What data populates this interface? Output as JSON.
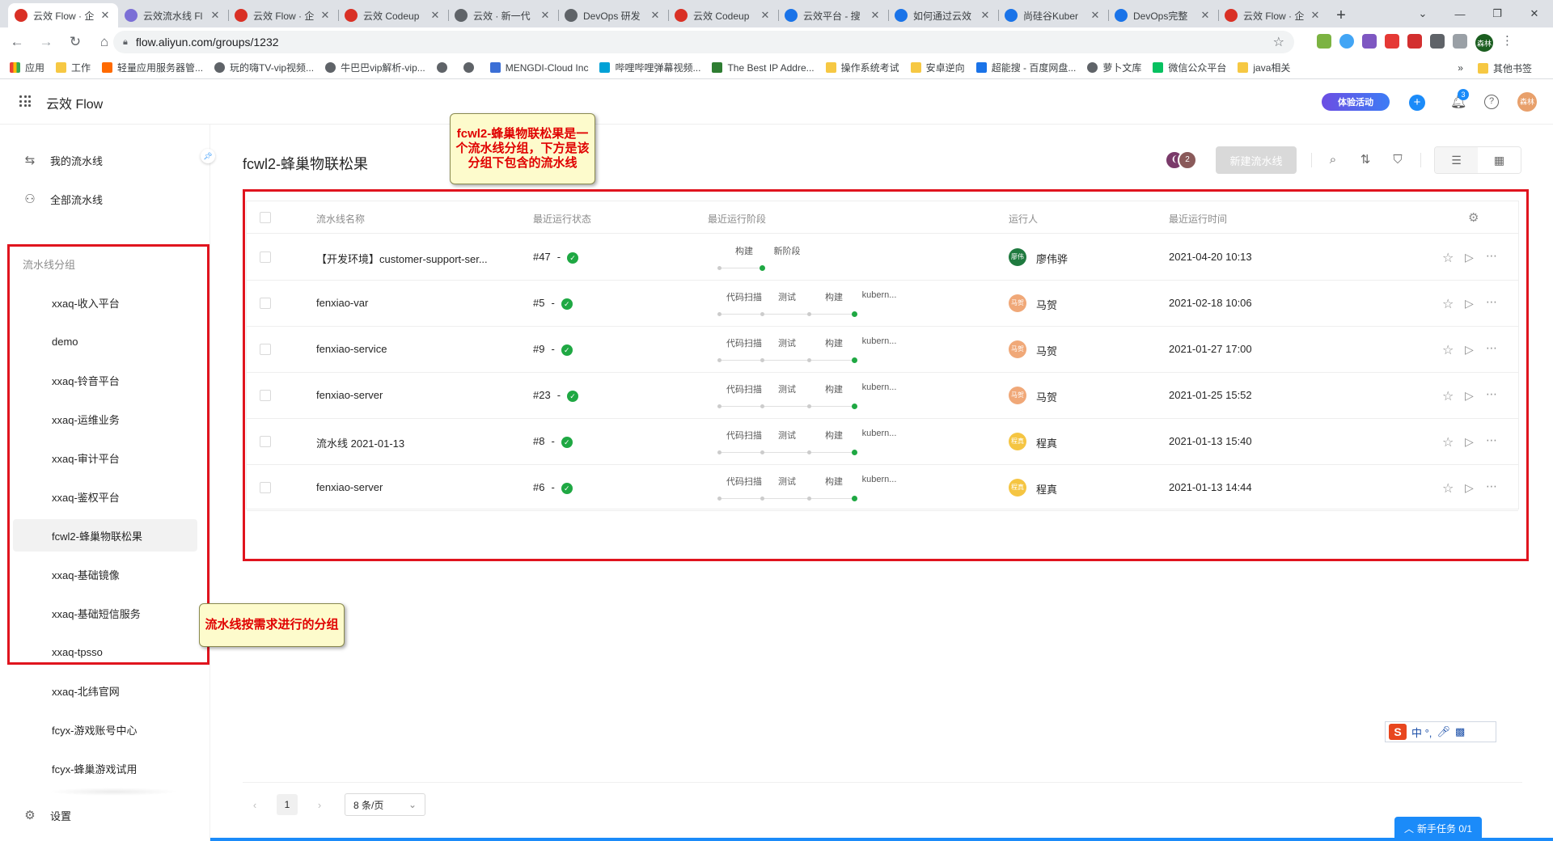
{
  "browser": {
    "tabs": [
      {
        "title": "云效 Flow · 企",
        "active": true,
        "icon_color": "#d93025"
      },
      {
        "title": "云效流水线 Fl",
        "active": false,
        "icon_color": "#7b6fd6"
      },
      {
        "title": "云效 Flow · 企",
        "active": false,
        "icon_color": "#d93025"
      },
      {
        "title": "云效 Codeup",
        "active": false,
        "icon_color": "#d93025"
      },
      {
        "title": "云效 · 新一代",
        "active": false,
        "icon_color": "#5f6368"
      },
      {
        "title": "DevOps 研发",
        "active": false,
        "icon_color": "#5f6368"
      },
      {
        "title": "云效 Codeup",
        "active": false,
        "icon_color": "#d93025"
      },
      {
        "title": "云效平台 - 搜",
        "active": false,
        "icon_color": "#1a73e8"
      },
      {
        "title": "如何通过云效",
        "active": false,
        "icon_color": "#1a73e8"
      },
      {
        "title": "尚硅谷Kuber",
        "active": false,
        "icon_color": "#1a73e8"
      },
      {
        "title": "DevOps完整",
        "active": false,
        "icon_color": "#1a73e8"
      },
      {
        "title": "云效 Flow · 企",
        "active": false,
        "icon_color": "#d93025"
      }
    ],
    "new_tab": "+",
    "url": "flow.aliyun.com/groups/1232",
    "bookmarks": [
      {
        "label": "应用",
        "icon": "apps-icon"
      },
      {
        "label": "工作",
        "icon": "folder-icon"
      },
      {
        "label": "轻量应用服务器管...",
        "icon": "aliyun-icon"
      },
      {
        "label": "玩的嗨TV-vip视频...",
        "icon": "globe-icon"
      },
      {
        "label": "牛巴巴vip解析-vip...",
        "icon": "globe-icon"
      },
      {
        "label": "",
        "icon": "globe-icon"
      },
      {
        "label": "",
        "icon": "globe-icon"
      },
      {
        "label": "MENGDI-Cloud Inc",
        "icon": "cloud-icon"
      },
      {
        "label": "哔哩哔哩弹幕视频...",
        "icon": "bilibili-icon"
      },
      {
        "label": "The Best IP Addre...",
        "icon": "ip-icon"
      },
      {
        "label": "操作系统考试",
        "icon": "folder-icon"
      },
      {
        "label": "安卓逆向",
        "icon": "folder-icon"
      },
      {
        "label": "超能搜 - 百度网盘...",
        "icon": "search-engine-icon"
      },
      {
        "label": "萝卜文库",
        "icon": "globe-icon"
      },
      {
        "label": "微信公众平台",
        "icon": "wechat-icon"
      },
      {
        "label": "java相关",
        "icon": "folder-icon"
      }
    ],
    "bookmarks_more": "»",
    "other_bookmarks": "其他书签",
    "profile_label": "森林"
  },
  "app": {
    "brand": "云效 Flow",
    "trial_label": "体验活动",
    "notification_count": "3",
    "help": "?",
    "user_avatar": "森林"
  },
  "sidebar": {
    "nav": [
      {
        "label": "我的流水线",
        "icon": "my-pipeline-icon",
        "glyph": "⇆"
      },
      {
        "label": "全部流水线",
        "icon": "all-pipeline-icon",
        "glyph": "⚇"
      }
    ],
    "group_title": "流水线分组",
    "groups": [
      {
        "label": "xxaq-收入平台",
        "active": false
      },
      {
        "label": "demo",
        "active": false
      },
      {
        "label": "xxaq-铃音平台",
        "active": false
      },
      {
        "label": "xxaq-运维业务",
        "active": false
      },
      {
        "label": "xxaq-审计平台",
        "active": false
      },
      {
        "label": "xxaq-鉴权平台",
        "active": false
      },
      {
        "label": "fcwl2-蜂巢物联松果",
        "active": true
      },
      {
        "label": "xxaq-基础镜像",
        "active": false
      },
      {
        "label": "xxaq-基础短信服务",
        "active": false
      },
      {
        "label": "xxaq-tpsso",
        "active": false
      },
      {
        "label": "xxaq-北纬官网",
        "active": false
      },
      {
        "label": "fcyx-游戏账号中心",
        "active": false
      },
      {
        "label": "fcyx-蜂巢游戏试用",
        "active": false
      }
    ],
    "settings_label": "设置"
  },
  "main": {
    "title": "fcwl2-蜂巢物联松果",
    "member_count": "2",
    "new_pipeline_label": "新建流水线",
    "columns": [
      "流水线名称",
      "最近运行状态",
      "最近运行阶段",
      "运行人",
      "最近运行时间"
    ],
    "rows": [
      {
        "name": "【开发环境】customer-support-ser...",
        "run": "#47",
        "status": "-",
        "stages": [
          {
            "label": "构建",
            "done": false
          },
          {
            "label": "新阶段",
            "done": true
          }
        ],
        "runner": "廖伟骅",
        "avatar_text": "廖伟骅",
        "avatar_color": "#1f7a3f",
        "time": "2021-04-20 10:13"
      },
      {
        "name": "fenxiao-var",
        "run": "#5",
        "status": "-",
        "stages": [
          {
            "label": "代码扫描",
            "done": false
          },
          {
            "label": "测试",
            "done": false
          },
          {
            "label": "构建",
            "done": false
          },
          {
            "label": "kubern...",
            "done": true
          }
        ],
        "runner": "马贺",
        "avatar_text": "马贺",
        "avatar_color": "#f0a878",
        "time": "2021-02-18 10:06"
      },
      {
        "name": "fenxiao-service",
        "run": "#9",
        "status": "-",
        "stages": [
          {
            "label": "代码扫描",
            "done": false
          },
          {
            "label": "测试",
            "done": false
          },
          {
            "label": "构建",
            "done": false
          },
          {
            "label": "kubern...",
            "done": true
          }
        ],
        "runner": "马贺",
        "avatar_text": "马贺",
        "avatar_color": "#f0a878",
        "time": "2021-01-27 17:00"
      },
      {
        "name": "fenxiao-server",
        "run": "#23",
        "status": "-",
        "stages": [
          {
            "label": "代码扫描",
            "done": false
          },
          {
            "label": "测试",
            "done": false
          },
          {
            "label": "构建",
            "done": false
          },
          {
            "label": "kubern...",
            "done": true
          }
        ],
        "runner": "马贺",
        "avatar_text": "马贺",
        "avatar_color": "#f0a878",
        "time": "2021-01-25 15:52"
      },
      {
        "name": "流水线 2021-01-13",
        "run": "#8",
        "status": "-",
        "stages": [
          {
            "label": "代码扫描",
            "done": false
          },
          {
            "label": "测试",
            "done": false
          },
          {
            "label": "构建",
            "done": false
          },
          {
            "label": "kubern...",
            "done": true
          }
        ],
        "runner": "程真",
        "avatar_text": "程真",
        "avatar_color": "#f5c542",
        "time": "2021-01-13 15:40"
      },
      {
        "name": "fenxiao-server",
        "run": "#6",
        "status": "-",
        "stages": [
          {
            "label": "代码扫描",
            "done": false
          },
          {
            "label": "测试",
            "done": false
          },
          {
            "label": "构建",
            "done": false
          },
          {
            "label": "kubern...",
            "done": true
          }
        ],
        "runner": "程真",
        "avatar_text": "程真",
        "avatar_color": "#f5c542",
        "time": "2021-01-13 14:44"
      }
    ],
    "pagination": {
      "current": "1",
      "page_size": "8 条/页"
    },
    "task_label": "新手任务 0/1",
    "ime_label": "中 °,"
  },
  "annotations": {
    "title_callout": "fcwl2-蜂巢物联松果是一个流水线分组，下方是该分组下包含的流水线",
    "sidebar_callout": "流水线按需求进行的分组"
  },
  "colors": {
    "accent": "#1b8bf9",
    "success": "#1fa843",
    "annotation_red": "#e0141e",
    "callout_bg": "#fdfbcc"
  }
}
